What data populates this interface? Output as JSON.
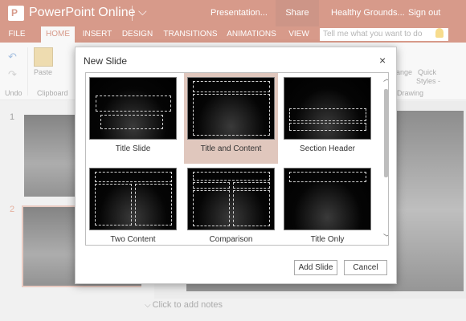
{
  "app": {
    "name": "PowerPoint Online",
    "logo_letter": "P",
    "doc_name": "Presentation...",
    "share_label": "Share",
    "user_name": "Healthy Grounds...",
    "signout_label": "Sign out"
  },
  "tabs": [
    {
      "label": "FILE"
    },
    {
      "label": "HOME"
    },
    {
      "label": "INSERT"
    },
    {
      "label": "DESIGN"
    },
    {
      "label": "TRANSITIONS"
    },
    {
      "label": "ANIMATIONS"
    },
    {
      "label": "VIEW"
    }
  ],
  "tell_me": {
    "placeholder": "Tell me what you want to do"
  },
  "ribbon": {
    "undo_label": "Undo",
    "clipboard_label": "Clipboard",
    "paste_label": "Paste",
    "drawing_label": "Drawing",
    "arrange_label": "ange",
    "quick_styles_label1": "Quick",
    "quick_styles_label2": "Styles -"
  },
  "thumbnails": [
    {
      "number": "1"
    },
    {
      "number": "2"
    }
  ],
  "notes": {
    "placeholder": "Click to add notes"
  },
  "dialog": {
    "title": "New Slide",
    "close_symbol": "×",
    "layouts": [
      {
        "label": "Title Slide"
      },
      {
        "label": "Title and Content"
      },
      {
        "label": "Section Header"
      },
      {
        "label": "Two Content"
      },
      {
        "label": "Comparison"
      },
      {
        "label": "Title Only"
      }
    ],
    "add_button": "Add Slide",
    "cancel_button": "Cancel"
  },
  "colors": {
    "brand": "#b7472a",
    "selected_layout": "#e0c7bd"
  }
}
